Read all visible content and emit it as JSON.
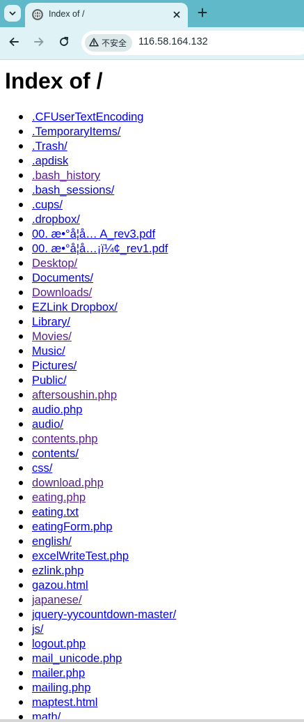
{
  "browser": {
    "tab": {
      "title": "Index of /"
    },
    "address_bar": {
      "security_label": "不安全",
      "url": "116.58.164.132"
    },
    "icons": {
      "tab_search": "chevron-down-icon",
      "favicon": "globe-icon",
      "tab_close": "close-icon",
      "new_tab": "plus-icon",
      "back": "back-arrow-icon",
      "forward": "forward-arrow-icon",
      "reload": "reload-icon",
      "security": "warning-triangle-icon"
    }
  },
  "page": {
    "heading": "Index of /",
    "link_color": "#0000ee",
    "visited_link_color": "#551a8b",
    "entries": [
      {
        "name": ".CFUserTextEncoding",
        "visited": false
      },
      {
        "name": ".TemporaryItems/",
        "visited": false
      },
      {
        "name": ".Trash/",
        "visited": false
      },
      {
        "name": ".apdisk",
        "visited": false
      },
      {
        "name": ".bash_history",
        "visited": true
      },
      {
        "name": ".bash_sessions/",
        "visited": false
      },
      {
        "name": ".cups/",
        "visited": false
      },
      {
        "name": ".dropbox/",
        "visited": false
      },
      {
        "name": "00. æ•°å¦å… A_rev3.pdf",
        "visited": false
      },
      {
        "name": "00. æ•°å¦å…¡ï¼¢_rev1.pdf",
        "visited": false
      },
      {
        "name": "Desktop/",
        "visited": true
      },
      {
        "name": "Documents/",
        "visited": false
      },
      {
        "name": "Downloads/",
        "visited": true
      },
      {
        "name": "EZLink Dropbox/",
        "visited": false
      },
      {
        "name": "Library/",
        "visited": false
      },
      {
        "name": "Movies/",
        "visited": true
      },
      {
        "name": "Music/",
        "visited": false
      },
      {
        "name": "Pictures/",
        "visited": false
      },
      {
        "name": "Public/",
        "visited": false
      },
      {
        "name": "aftersoushin.php",
        "visited": true
      },
      {
        "name": "audio.php",
        "visited": false
      },
      {
        "name": "audio/",
        "visited": false
      },
      {
        "name": "contents.php",
        "visited": true
      },
      {
        "name": "contents/",
        "visited": false
      },
      {
        "name": "css/",
        "visited": false
      },
      {
        "name": "download.php",
        "visited": true
      },
      {
        "name": "eating.php",
        "visited": true
      },
      {
        "name": "eating.txt",
        "visited": false
      },
      {
        "name": "eatingForm.php",
        "visited": false
      },
      {
        "name": "english/",
        "visited": false
      },
      {
        "name": "excelWriteTest.php",
        "visited": false
      },
      {
        "name": "ezlink.php",
        "visited": false
      },
      {
        "name": "gazou.html",
        "visited": false
      },
      {
        "name": "japanese/",
        "visited": true
      },
      {
        "name": "jquery-yycountdown-master/",
        "visited": false
      },
      {
        "name": "js/",
        "visited": false
      },
      {
        "name": "logout.php",
        "visited": false
      },
      {
        "name": "mail_unicode.php",
        "visited": false
      },
      {
        "name": "mailer.php",
        "visited": false
      },
      {
        "name": "mailing.php",
        "visited": false
      },
      {
        "name": "maptest.html",
        "visited": false
      },
      {
        "name": "math/",
        "visited": false
      }
    ]
  }
}
